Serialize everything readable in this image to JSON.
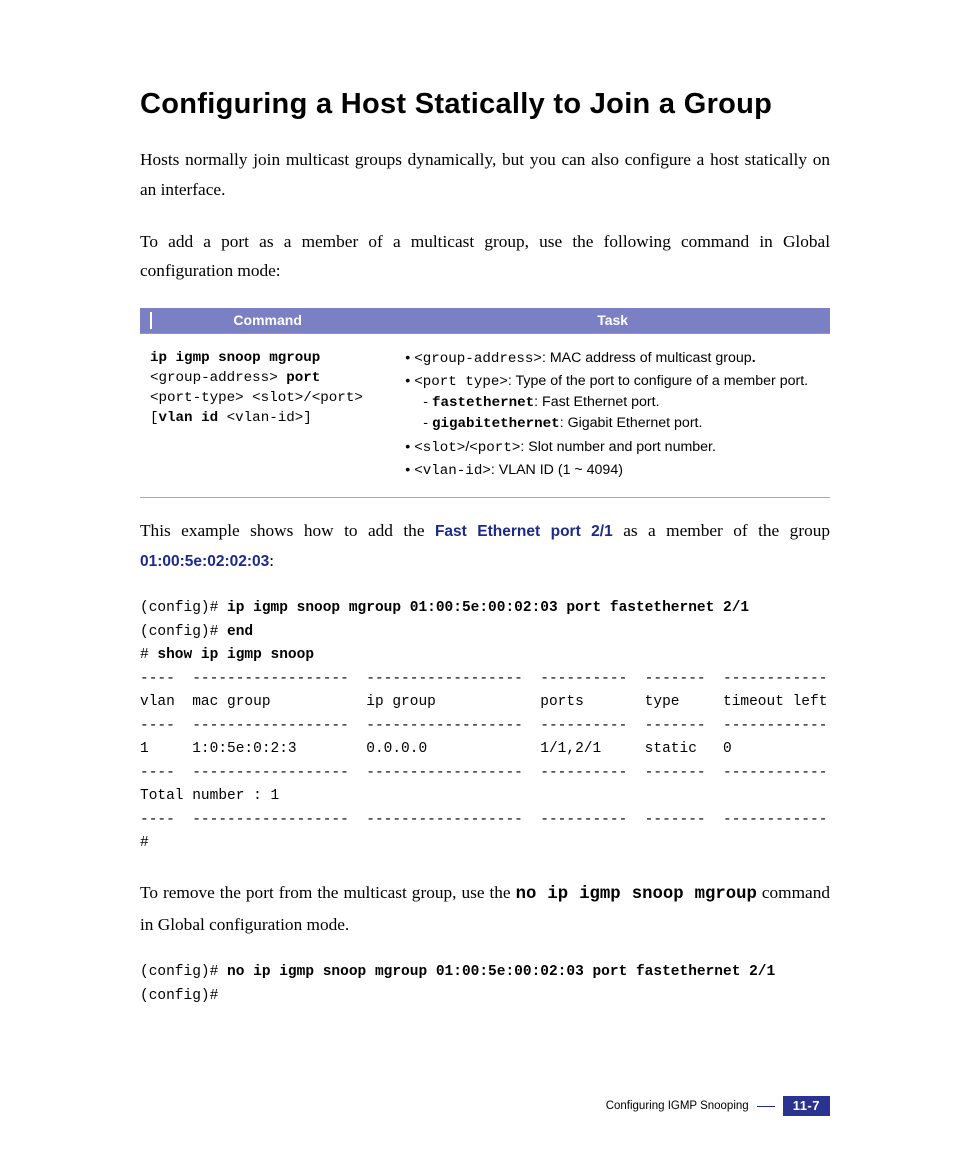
{
  "title": "Configuring a Host Statically to Join a Group",
  "para1": "Hosts normally join multicast groups dynamically, but you can also configure a host statically on an interface.",
  "para2": "To add a port as a member of a multicast group, use the following command in Global configuration mode:",
  "table": {
    "headers": {
      "command": "Command",
      "task": "Task"
    },
    "command": {
      "l1a": "ip igmp snoop mgroup",
      "l2a": "<group-address>",
      "l2b": " port",
      "l3a": "<port-type> <slot>",
      "l3b": "/",
      "l3c": "<port>",
      "l4a": "[",
      "l4b": "vlan id",
      "l4c": " <vlan-id>",
      "l4d": "]"
    },
    "task": {
      "b1_code": "<group-address>",
      "b1_txt": ": MAC address of multicast group",
      "b1_dot": ".",
      "b2_code": "<port type>",
      "b2_txt": ": Type of the port to configure of a member port.",
      "b2s1_code": "fastethernet",
      "b2s1_txt": ": Fast Ethernet port.",
      "b2s2_code": "gigabitethernet",
      "b2s2_txt": ": Gigabit Ethernet port.",
      "b3_code": "<slot>",
      "b3_slash": "/",
      "b3_code2": "<port>",
      "b3_txt": ": Slot number and port number.",
      "b4_code": "<vlan-id>",
      "b4_txt": ": VLAN ID (1 ~ 4094)"
    }
  },
  "para3": {
    "a": "This example shows how to add the ",
    "b": "Fast Ethernet port 2/1",
    "c": " as a member of the group ",
    "d": "01:00:5e:02:02:03",
    "e": ":"
  },
  "code1": {
    "l1p": "(config)# ",
    "l1c": "ip igmp snoop mgroup 01:00:5e:00:02:03 port fastethernet 2/1",
    "l2p": "(config)# ",
    "l2c": "end",
    "l3p": "# ",
    "l3c": "show ip igmp snoop",
    "sep": "----  ------------------  ------------------  ----------  -------  ------------",
    "hdr": "vlan  mac group           ip group            ports       type     timeout left",
    "row": "1     1:0:5e:0:2:3        0.0.0.0             1/1,2/1     static   0",
    "tot": "Total number : 1",
    "end": "#"
  },
  "para4": {
    "a": "To remove the port from the multicast group, use the ",
    "b": "no ip igmp snoop mgroup",
    "c": " command in Global configuration mode."
  },
  "code2": {
    "l1p": "(config)# ",
    "l1c": "no ip igmp snoop mgroup 01:00:5e:00:02:03 port fastethernet 2/1",
    "l2": "(config)#"
  },
  "footer": {
    "text": "Configuring IGMP Snooping",
    "page": "11-7"
  }
}
